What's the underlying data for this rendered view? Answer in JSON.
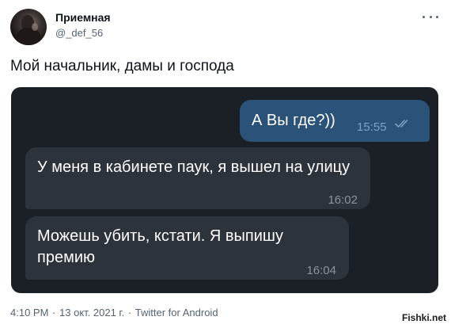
{
  "tweet": {
    "author_name": "Приемная",
    "author_handle": "@_def_56",
    "text": "Мой начальник, дамы и господа",
    "meta": {
      "time": "4:10 PM",
      "separator": "·",
      "date": "13 окт. 2021 г.",
      "client": "Twitter for Android"
    },
    "icons": {
      "more": "more-horizontal-icon",
      "read_ticks": "double-check-icon"
    }
  },
  "chat": {
    "messages": [
      {
        "direction": "outgoing",
        "text": "А Вы где?))",
        "time": "15:55"
      },
      {
        "direction": "incoming",
        "text": "У меня в кабинете паук, я вышел на улицу",
        "time": "16:02"
      },
      {
        "direction": "incoming",
        "text": "Можешь убить, кстати. Я выпишу премию",
        "time": "16:04"
      }
    ],
    "colors": {
      "background": "#1b2026",
      "outgoing_bubble": "#2b5278",
      "incoming_bubble": "#2d333b"
    }
  },
  "watermark": "Fishki.net"
}
